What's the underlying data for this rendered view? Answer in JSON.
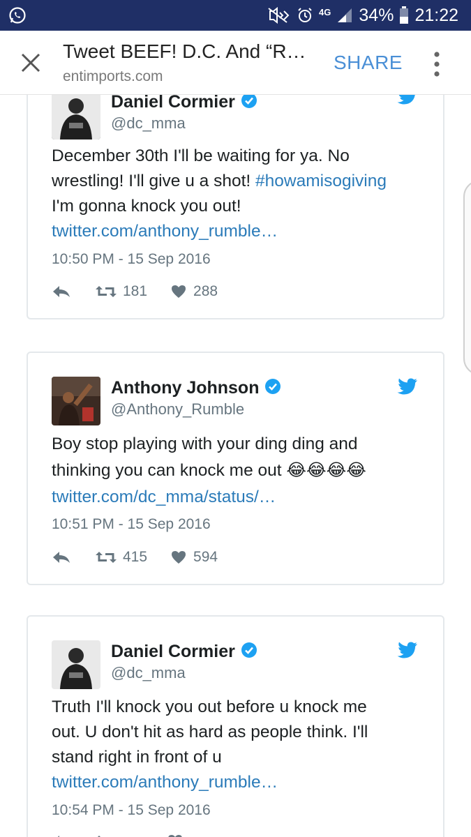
{
  "status_bar": {
    "network": "4G",
    "battery": "34%",
    "time": "21:22"
  },
  "toolbar": {
    "title": "Tweet BEEF! D.C. And “R…",
    "domain": "entimports.com",
    "share_label": "SHARE"
  },
  "tweets": [
    {
      "name": "Daniel Cormier",
      "handle": "@dc_mma",
      "text_lines": [
        "December 30th I'll be waiting for ya. No",
        "wrestling! I'll give u a shot! ",
        "I'm gonna knock you out!"
      ],
      "hashtag": "#howamisogiving",
      "link": "twitter.com/anthony_rumble…",
      "time": "10:50 PM - 15 Sep 2016",
      "retweets": "181",
      "likes": "288"
    },
    {
      "name": "Anthony Johnson",
      "handle": "@Anthony_Rumble",
      "text_lines": [
        "Boy stop playing with your ding ding and",
        "thinking you can knock me out "
      ],
      "emoji": "😂😂😂😂",
      "link": "twitter.com/dc_mma/status/…",
      "time": "10:51 PM - 15 Sep 2016",
      "retweets": "415",
      "likes": "594"
    },
    {
      "name": "Daniel Cormier",
      "handle": "@dc_mma",
      "text_lines": [
        "Truth I'll knock you out before u knock me",
        "out. U don't hit as hard as people think. I'll",
        "stand right in front of u"
      ],
      "link": "twitter.com/anthony_rumble…",
      "time": "10:54 PM - 15 Sep 2016"
    }
  ],
  "colors": {
    "status_bar": "#1f2f66",
    "link": "#2b7bb9",
    "share": "#4a8fd6",
    "twitter_blue": "#1da1f2",
    "muted": "#66757f"
  },
  "icons": [
    "whatsapp-icon",
    "mute-icon",
    "alarm-icon",
    "signal-icon",
    "battery-icon",
    "close-icon",
    "more-icon",
    "verified-icon",
    "twitter-bird-icon",
    "reply-icon",
    "retweet-icon",
    "heart-icon"
  ]
}
